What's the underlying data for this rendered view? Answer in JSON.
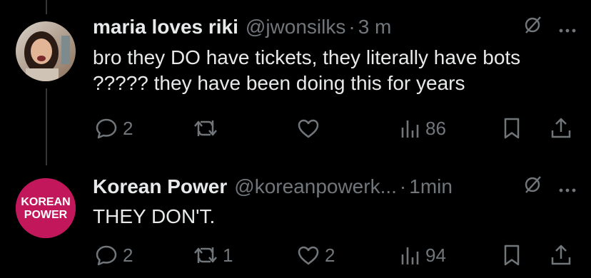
{
  "tweets": [
    {
      "display_name": "maria loves riki",
      "handle": "@jwonsilks",
      "separator": "·",
      "time": "3 m",
      "text": "bro they DO have tickets, they literally have bots ????? they have been doing this for years",
      "stats": {
        "replies": "2",
        "retweets": "",
        "likes": "",
        "views": "86"
      }
    },
    {
      "display_name": "Korean Power",
      "handle": "@koreanpowerk...",
      "separator": "·",
      "time": "1min",
      "avatar_text": [
        "KOREAN",
        "POWER"
      ],
      "text": "THEY DON'T.",
      "stats": {
        "replies": "2",
        "retweets": "1",
        "likes": "2",
        "views": "94"
      }
    }
  ],
  "icons": [
    "reply-icon",
    "retweet-icon",
    "like-icon",
    "views-icon",
    "bookmark-icon",
    "share-icon",
    "grok-icon",
    "more-icon"
  ],
  "colors": {
    "background": "#000000",
    "text": "#e7e9ea",
    "muted": "#71767b",
    "brand_avatar": "#c2185b"
  }
}
